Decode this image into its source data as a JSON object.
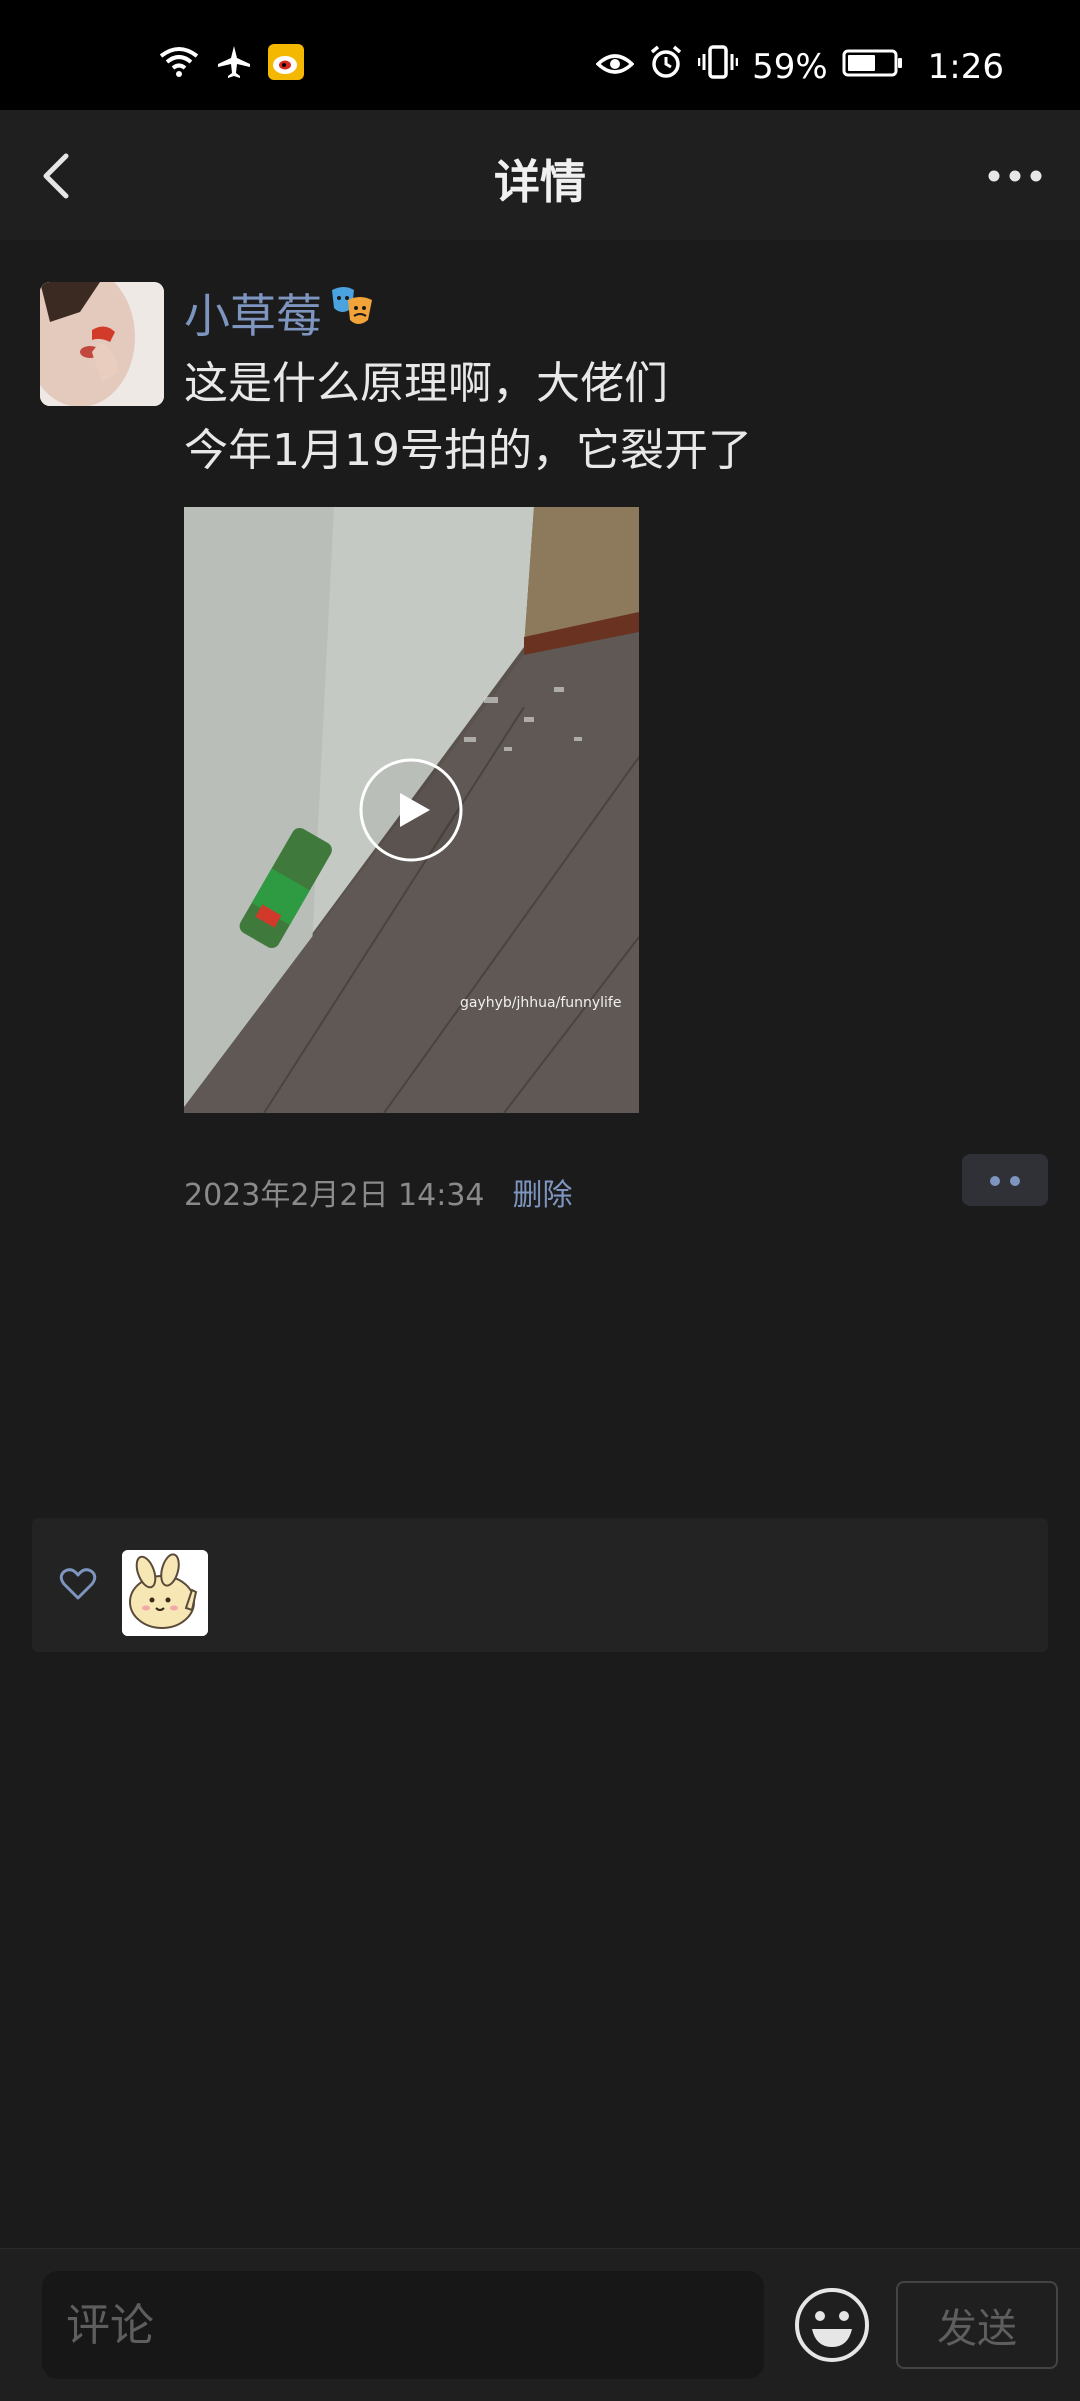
{
  "status_bar": {
    "battery": "59%",
    "time": "1:26",
    "icons": [
      "wifi-icon",
      "airplane-icon",
      "weibo-icon",
      "eye-icon",
      "alarm-icon",
      "vibrate-icon",
      "battery-icon"
    ]
  },
  "nav": {
    "title": "详情",
    "icons": [
      "back-icon",
      "more-icon"
    ]
  },
  "post": {
    "username": "小草莓",
    "text_line1": "这是什么原理啊，大佬们",
    "text_line2": "今年1月19号拍的，它裂开了",
    "video_watermark": "gayhyb/jhhua/funnylife",
    "timestamp": "2023年2月2日 14:34",
    "delete_label": "删除"
  },
  "bottom": {
    "comment_placeholder": "评论",
    "send_label": "发送"
  },
  "colors": {
    "background": "#1b1b1b",
    "accent": "#7d95bf",
    "status_bar": "#000000"
  }
}
